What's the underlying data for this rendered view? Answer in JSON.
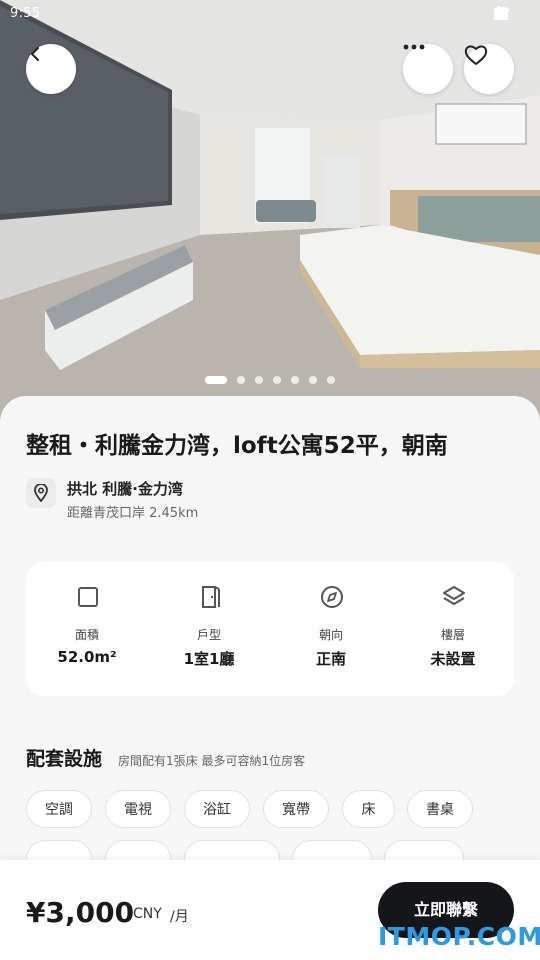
{
  "status_bar": {
    "time": "9:55"
  },
  "gallery": {
    "image_count": 8,
    "active_index": 0
  },
  "listing": {
    "title": "整租・利騰金力湾，loft公寓52平，朝南",
    "location_name": "拱北 利騰·金力湾",
    "distance": "距離青茂口岸 2.45km"
  },
  "specs": [
    {
      "label": "面積",
      "value": "52.0m²",
      "icon": "square-icon"
    },
    {
      "label": "戶型",
      "value": "1室1廳",
      "icon": "door-icon"
    },
    {
      "label": "朝向",
      "value": "正南",
      "icon": "compass-icon"
    },
    {
      "label": "樓層",
      "value": "未設置",
      "icon": "layers-icon"
    }
  ],
  "facilities": {
    "title": "配套設施",
    "note": "房間配有1張床 最多可容納1位房客",
    "chips": [
      "空調",
      "電視",
      "浴缸",
      "寬帶",
      "床",
      "書桌"
    ]
  },
  "bottom_bar": {
    "price": "¥3,000",
    "currency": "CNY",
    "period": "/月",
    "cta": "立即聯繫",
    "watermark": "ITMOP.COM"
  },
  "colors": {
    "cta_bg": "#15161a",
    "watermark": "#2e9be0"
  }
}
